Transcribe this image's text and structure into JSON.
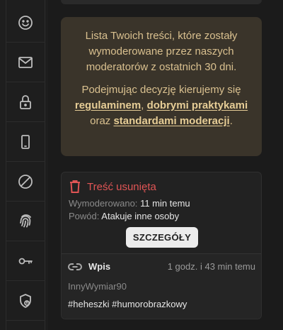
{
  "sidebar": {
    "items": [
      {
        "icon": "smiley-icon"
      },
      {
        "icon": "mail-icon"
      },
      {
        "icon": "lock-icon"
      },
      {
        "icon": "phone-icon"
      },
      {
        "icon": "block-icon"
      },
      {
        "icon": "fingerprint-icon"
      },
      {
        "icon": "key-icon"
      },
      {
        "icon": "shield-icon"
      }
    ]
  },
  "info": {
    "line1": "Lista Twoich treści, które zostały wymoderowane przez naszych moderatorów z ostatnich 30 dni.",
    "line2_prefix": "Podejmując decyzję kierujemy się",
    "link_rules": "regulaminem",
    "comma": ",",
    "link_practices": "dobrymi praktykami",
    "oraz": "oraz",
    "link_standards": "standardami moderacji",
    "dot": "."
  },
  "card": {
    "title": "Treść usunięta",
    "moderated_key": "Wymoderowano:",
    "moderated_value": "11 min temu",
    "reason_key": "Powód:",
    "reason_value": "Atakuje inne osoby",
    "details_label": "SZCZEGÓŁY",
    "entry": {
      "type": "Wpis",
      "time": "1 godz. i 43 min temu",
      "author": "InnyWymiar90",
      "tags": "#heheszki #humorobrazkowy"
    }
  },
  "colors": {
    "danger": "#e05555",
    "info_bg": "#3a342a",
    "info_text": "#d9c08f"
  }
}
